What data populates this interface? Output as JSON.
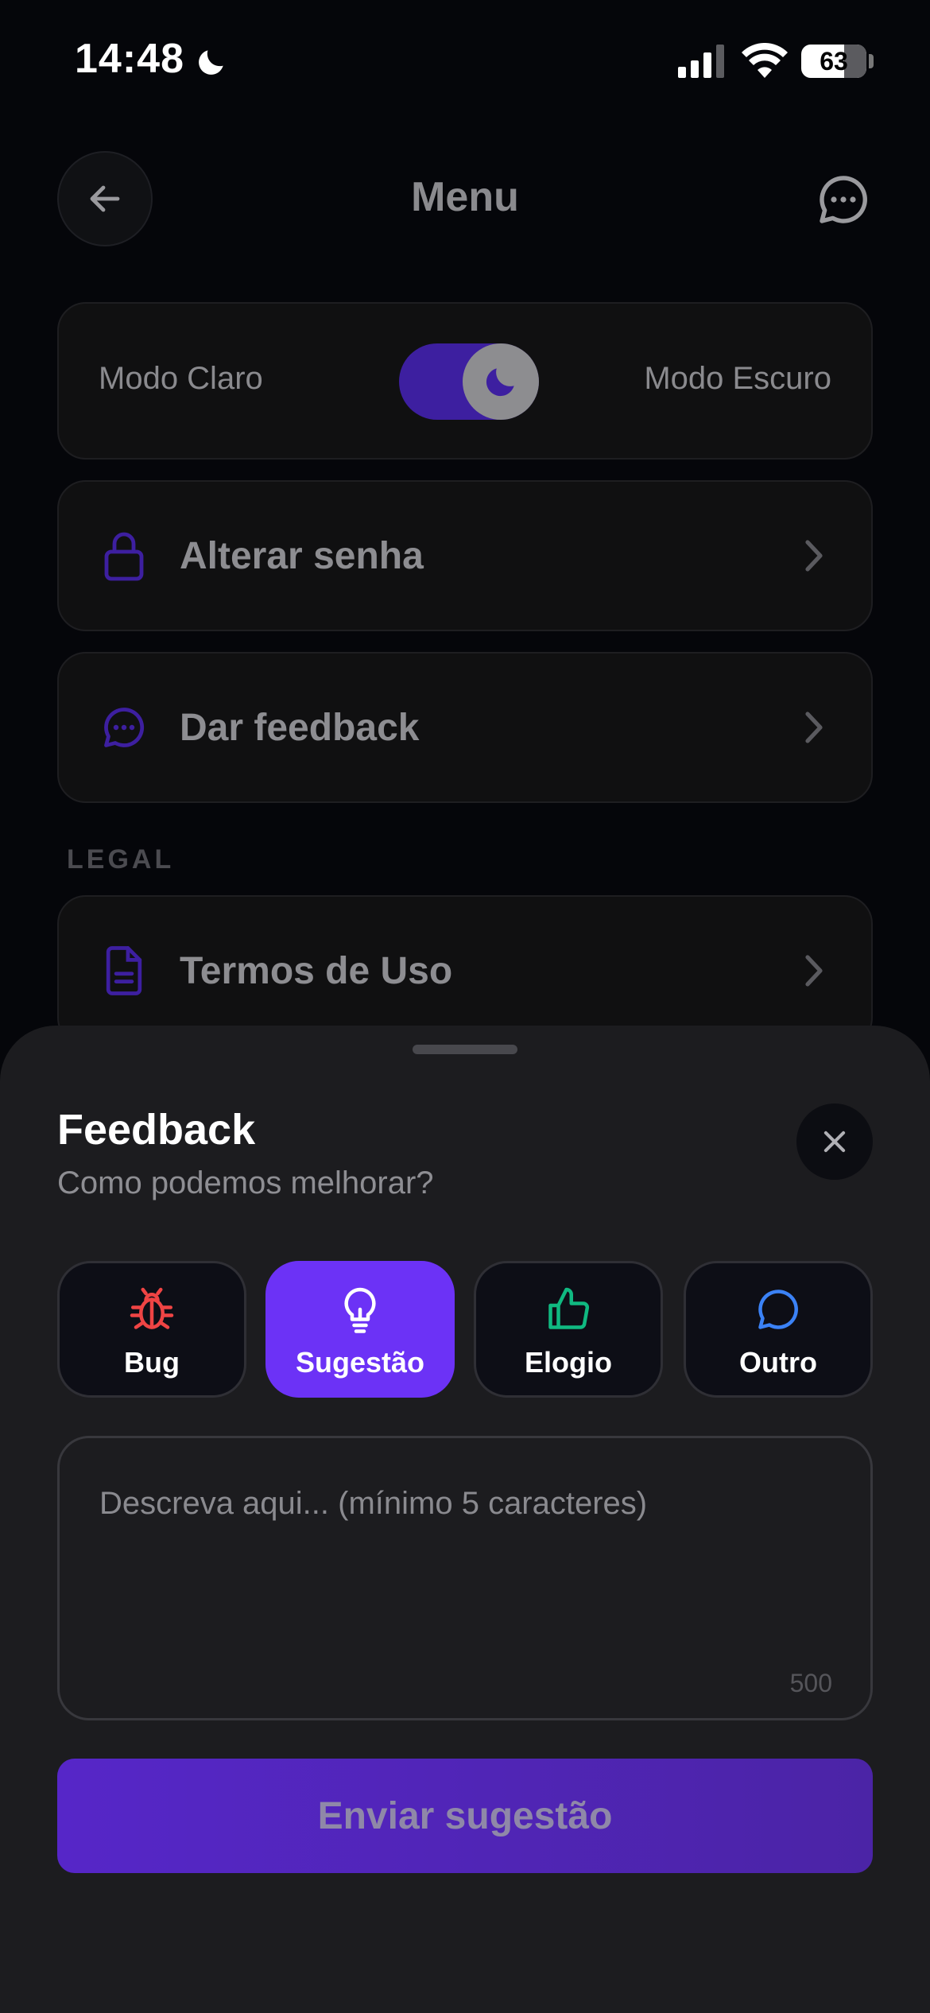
{
  "status_bar": {
    "time": "14:48",
    "battery_level": "63"
  },
  "header": {
    "title": "Menu"
  },
  "theme": {
    "light_label": "Modo Claro",
    "dark_label": "Modo Escuro",
    "dark_mode_on": true,
    "accent_color": "#3d1fa0"
  },
  "menu": {
    "change_password": "Alterar senha",
    "give_feedback": "Dar feedback",
    "legal_section": "LEGAL",
    "terms": "Termos de Uso"
  },
  "sheet": {
    "title": "Feedback",
    "subtitle": "Como podemos melhorar?",
    "types": [
      {
        "label": "Bug",
        "icon": "bug-icon",
        "color": "#ef4444",
        "selected": false
      },
      {
        "label": "Sugestão",
        "icon": "lightbulb-icon",
        "color": "#ffffff",
        "selected": true
      },
      {
        "label": "Elogio",
        "icon": "thumbs-up-icon",
        "color": "#10b981",
        "selected": false
      },
      {
        "label": "Outro",
        "icon": "chat-bubble-icon",
        "color": "#3b82f6",
        "selected": false
      }
    ],
    "textarea_placeholder": "Descreva aqui... (mínimo 5 caracteres)",
    "textarea_value": "",
    "char_count": "500",
    "submit_label": "Enviar sugestão",
    "selected_color": "#6c32f6"
  }
}
